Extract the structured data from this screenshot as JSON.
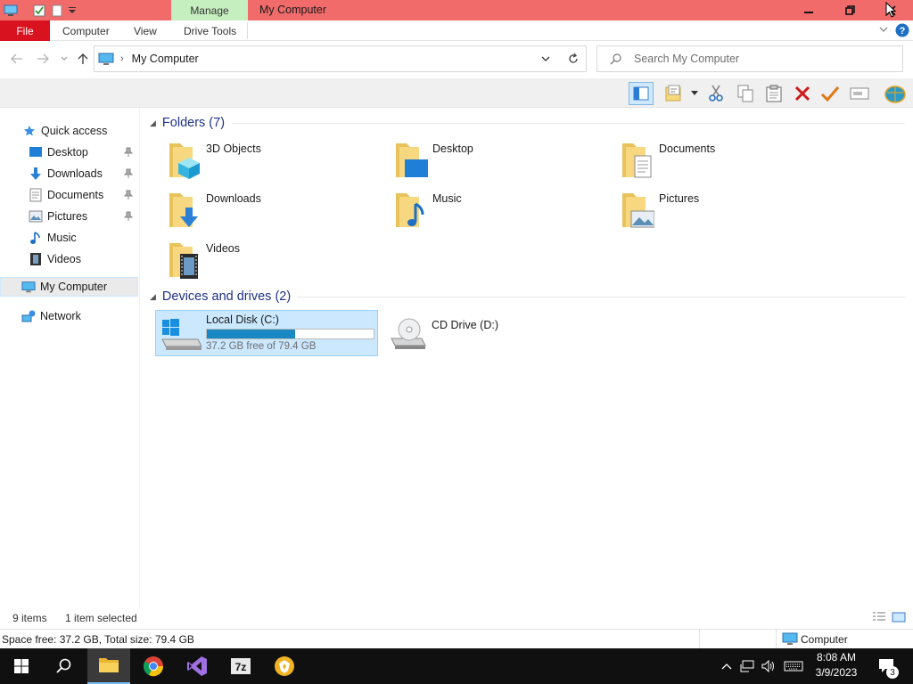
{
  "titlebar": {
    "manage_label": "Manage",
    "title": "My Computer"
  },
  "ribbon": {
    "file_label": "File",
    "tabs": [
      {
        "label": "Computer"
      },
      {
        "label": "View"
      },
      {
        "label": "Drive Tools"
      }
    ]
  },
  "address": {
    "path": "My Computer",
    "search_placeholder": "Search My Computer"
  },
  "nav": {
    "quick_access": "Quick access",
    "items": [
      {
        "label": "Desktop",
        "pinned": true
      },
      {
        "label": "Downloads",
        "pinned": true
      },
      {
        "label": "Documents",
        "pinned": true
      },
      {
        "label": "Pictures",
        "pinned": true
      },
      {
        "label": "Music",
        "pinned": false
      },
      {
        "label": "Videos",
        "pinned": false
      }
    ],
    "my_computer": "My Computer",
    "network": "Network"
  },
  "content": {
    "folders_header": "Folders (7)",
    "folders": [
      {
        "name": "3D Objects"
      },
      {
        "name": "Desktop"
      },
      {
        "name": "Documents"
      },
      {
        "name": "Downloads"
      },
      {
        "name": "Music"
      },
      {
        "name": "Pictures"
      },
      {
        "name": "Videos"
      }
    ],
    "drives_header": "Devices and drives (2)",
    "drives": [
      {
        "name": "Local Disk (C:)",
        "free_text": "37.2 GB free of 79.4 GB",
        "used_fraction": 0.53
      },
      {
        "name": "CD Drive (D:)"
      }
    ]
  },
  "status": {
    "items_count": "9 items",
    "selected": "1 item selected",
    "space_info": "Space free: 37.2 GB, Total size: 79.4 GB",
    "location": "Computer"
  },
  "taskbar": {
    "time": "8:08 AM",
    "date": "3/9/2023",
    "notifications": "3"
  },
  "colors": {
    "titlebar": "#f26b6b",
    "file_tab": "#d9121f",
    "manage_tab": "#c6efc0",
    "selection": "#cce8ff",
    "header_text": "#1e3287"
  }
}
